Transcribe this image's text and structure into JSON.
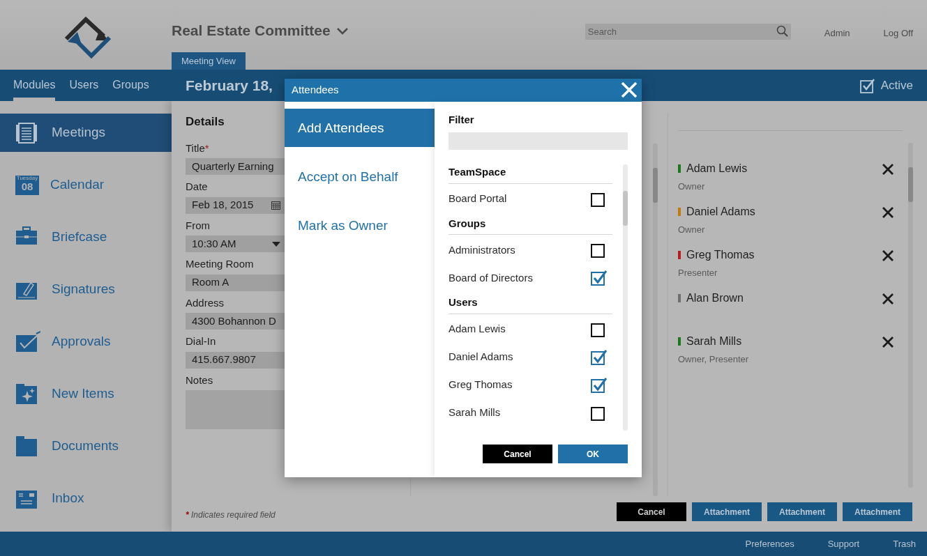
{
  "header": {
    "title": "Real Estate Committee",
    "view_tab": "Meeting View",
    "search": {
      "placeholder": "Search"
    },
    "user_links": [
      "Admin",
      "Log Off"
    ]
  },
  "nav_tabs": [
    {
      "label": "Modules",
      "selected": true
    },
    {
      "label": "Users",
      "selected": false
    },
    {
      "label": "Groups",
      "selected": false
    }
  ],
  "meeting": {
    "date_title": "February 18,",
    "status": {
      "label": "Active",
      "checked": true
    }
  },
  "sidebar": {
    "items": [
      {
        "label": "Meetings",
        "selected": true
      },
      {
        "label": "Calendar",
        "selected": false,
        "icon_text": [
          "Tuesday",
          "08"
        ]
      },
      {
        "label": "Briefcase",
        "selected": false
      },
      {
        "label": "Signatures",
        "selected": false
      },
      {
        "label": "Approvals",
        "selected": false
      },
      {
        "label": "New Items",
        "selected": false
      },
      {
        "label": "Documents",
        "selected": false
      },
      {
        "label": "Inbox",
        "selected": false
      }
    ]
  },
  "details": {
    "heading": "Details",
    "fields": [
      {
        "label": "Title",
        "required_mark": "*",
        "kind": "text",
        "value": "Quarterly Earning"
      },
      {
        "label": "Date",
        "kind": "date",
        "value": "Feb 18, 2015"
      },
      {
        "label": "From",
        "kind": "select",
        "value": "10:30 AM"
      },
      {
        "label": "Meeting Room",
        "kind": "text",
        "value": "Room A"
      },
      {
        "label": "Address",
        "kind": "text",
        "value": "4300 Bohannon D"
      },
      {
        "label": "Dial-In",
        "kind": "text",
        "value": "415.667.9807"
      },
      {
        "label": "Notes",
        "kind": "textarea"
      }
    ]
  },
  "required_note": {
    "mark": "*",
    "text": "Indicates required field"
  },
  "attendees": [
    {
      "name": "Adam Lewis",
      "role": "Owner",
      "color": "#1a7a1a"
    },
    {
      "name": "Daniel Adams",
      "role": "Owner",
      "color": "#c47a10"
    },
    {
      "name": "Greg Thomas",
      "role": "Presenter",
      "color": "#b81c1c"
    },
    {
      "name": "Alan Brown",
      "color": "#6e6e6e"
    },
    {
      "name": "Sarah Mills",
      "role": "Owner, Presenter",
      "color": "#1a7a1a"
    }
  ],
  "buttons": [
    {
      "label": "Cancel",
      "kind": "cancel"
    },
    {
      "label": "Attachment",
      "kind": "primary"
    },
    {
      "label": "Attachment",
      "kind": "primary"
    },
    {
      "label": "Attachment",
      "kind": "primary"
    }
  ],
  "footer_links": [
    "Preferences",
    "Support",
    "Trash"
  ],
  "dialog": {
    "title": "Attendees",
    "actions": [
      {
        "label": "Add Attendees",
        "selected": true
      },
      {
        "label": "Accept on Behalf",
        "selected": false
      },
      {
        "label": "Mark as Owner",
        "selected": false
      }
    ],
    "filter": {
      "label": "Filter"
    },
    "groups": [
      {
        "heading": "TeamSpace",
        "items": [
          {
            "label": "Board Portal",
            "checked": false
          }
        ]
      },
      {
        "heading": "Groups",
        "items": [
          {
            "label": "Administrators",
            "checked": false
          },
          {
            "label": "Board of Directors",
            "checked": true
          }
        ]
      },
      {
        "heading": "Users",
        "items": [
          {
            "label": "Adam Lewis",
            "checked": false
          },
          {
            "label": "Daniel Adams",
            "checked": true
          },
          {
            "label": "Greg Thomas",
            "checked": true
          },
          {
            "label": "Sarah Mills",
            "checked": false
          }
        ]
      }
    ],
    "buttons": [
      {
        "label": "Cancel",
        "kind": "cancel"
      },
      {
        "label": "OK",
        "kind": "primary"
      }
    ]
  }
}
